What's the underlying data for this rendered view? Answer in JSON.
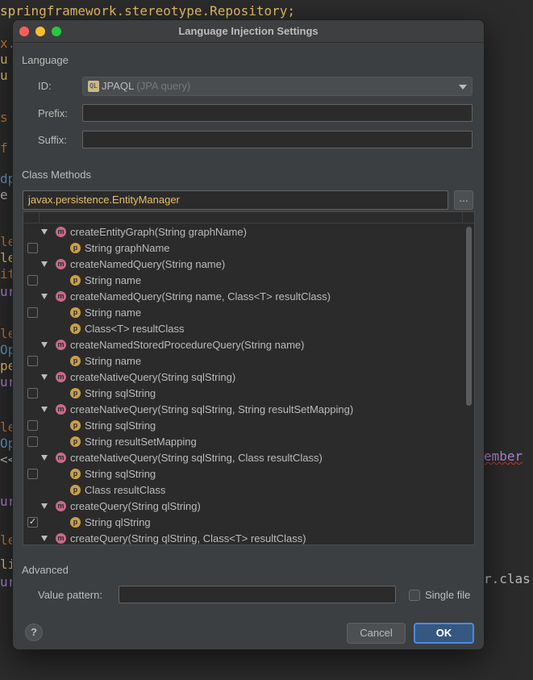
{
  "editor": {
    "line1": "springframework.stereotype.Repository;",
    "right_member": "ember",
    "right_clas": "r.clas",
    "gutter_fragments": [
      "x.",
      "u",
      "u",
      "s",
      "f",
      "dp",
      "e",
      "le",
      "le",
      "it",
      "ur",
      "le",
      "Op",
      "pe",
      "ur",
      "le",
      "Op",
      "<<",
      "ur",
      "le",
      "li",
      "ur"
    ]
  },
  "dialog": {
    "title": "Language Injection Settings",
    "language_section": "Language",
    "id_label": "ID:",
    "id_value": "JPAQL",
    "id_hint": "(JPA query)",
    "id_icon": "jpa-icon",
    "prefix_label": "Prefix:",
    "prefix_value": "",
    "suffix_label": "Suffix:",
    "suffix_value": "",
    "class_methods_section": "Class Methods",
    "class_name": "javax.persistence.EntityManager",
    "browse_label": "...",
    "advanced_section": "Advanced",
    "value_pattern_label": "Value pattern:",
    "value_pattern_value": "",
    "single_file_label": "Single file",
    "single_file_checked": false,
    "help_label": "?",
    "cancel_label": "Cancel",
    "ok_label": "OK"
  },
  "tree": {
    "rows": [
      {
        "kind": "method",
        "text": "createEntityGraph(String graphName)",
        "icon_letter": "m"
      },
      {
        "kind": "param",
        "text": "String graphName",
        "icon_letter": "p",
        "checked": false
      },
      {
        "kind": "method",
        "text": "createNamedQuery(String name)",
        "icon_letter": "m"
      },
      {
        "kind": "param",
        "text": "String name",
        "icon_letter": "p",
        "checked": false
      },
      {
        "kind": "method",
        "text": "createNamedQuery(String name, Class<T> resultClass)",
        "icon_letter": "m"
      },
      {
        "kind": "param",
        "text": "String name",
        "icon_letter": "p",
        "checked": false
      },
      {
        "kind": "param",
        "text": "Class<T> resultClass",
        "icon_letter": "p",
        "checked": null
      },
      {
        "kind": "method",
        "text": "createNamedStoredProcedureQuery(String name)",
        "icon_letter": "m"
      },
      {
        "kind": "param",
        "text": "String name",
        "icon_letter": "p",
        "checked": false
      },
      {
        "kind": "method",
        "text": "createNativeQuery(String sqlString)",
        "icon_letter": "m"
      },
      {
        "kind": "param",
        "text": "String sqlString",
        "icon_letter": "p",
        "checked": false
      },
      {
        "kind": "method",
        "text": "createNativeQuery(String sqlString, String resultSetMapping)",
        "icon_letter": "m"
      },
      {
        "kind": "param",
        "text": "String sqlString",
        "icon_letter": "p",
        "checked": false
      },
      {
        "kind": "param",
        "text": "String resultSetMapping",
        "icon_letter": "p",
        "checked": false
      },
      {
        "kind": "method",
        "text": "createNativeQuery(String sqlString, Class resultClass)",
        "icon_letter": "m"
      },
      {
        "kind": "param",
        "text": "String sqlString",
        "icon_letter": "p",
        "checked": false
      },
      {
        "kind": "param",
        "text": "Class resultClass",
        "icon_letter": "p",
        "checked": null
      },
      {
        "kind": "method",
        "text": "createQuery(String qlString)",
        "icon_letter": "m"
      },
      {
        "kind": "param",
        "text": "String qlString",
        "icon_letter": "p",
        "checked": true
      },
      {
        "kind": "method",
        "text": "createQuery(String qlString, Class<T> resultClass)",
        "icon_letter": "m"
      }
    ]
  },
  "colors": {
    "dialog_bg": "#3c3f41",
    "editor_bg": "#2b2b2b",
    "class_name_color": "#e8bf6a",
    "method_icon": "#c76a8a",
    "param_icon": "#c9a04a",
    "ok_border": "#4c8be0"
  }
}
